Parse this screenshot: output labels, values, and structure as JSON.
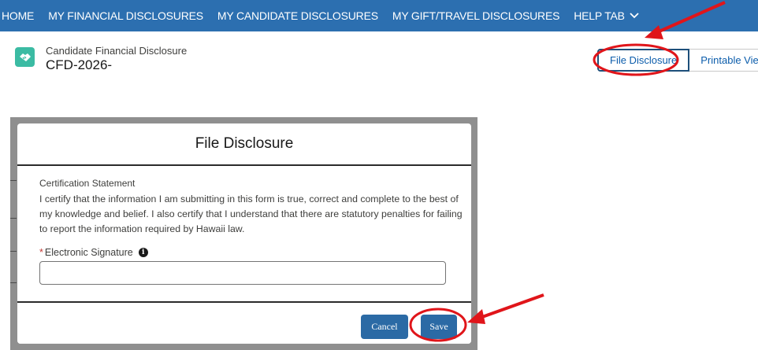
{
  "nav": {
    "items": [
      {
        "label": "HOME"
      },
      {
        "label": "MY FINANCIAL DISCLOSURES"
      },
      {
        "label": "MY CANDIDATE DISCLOSURES"
      },
      {
        "label": "MY GIFT/TRAVEL DISCLOSURES"
      },
      {
        "label": "HELP TAB"
      }
    ],
    "help_icon": "chevron-down-icon"
  },
  "record": {
    "type": "Candidate Financial Disclosure",
    "name": "CFD-2026-",
    "icon": "handshake-icon",
    "actions": {
      "file_disclosure": "File Disclosure",
      "printable_view": "Printable View"
    }
  },
  "modal": {
    "title": "File Disclosure",
    "cert_title": "Certification Statement",
    "cert_text": "I certify that the information I am submitting in this form is true, correct and complete to the best of my knowledge and belief. I also certify that I understand that there are statutory penalties for failing to report the information required by Hawaii law.",
    "field": {
      "required_mark": "*",
      "label": "Electronic Signature",
      "value": ""
    },
    "buttons": {
      "cancel": "Cancel",
      "save": "Save"
    }
  },
  "colors": {
    "nav_bg": "#2c6fb0",
    "brand_button": "#2b6aa5",
    "record_icon": "#3bbba3",
    "annotation_red": "#e0151a"
  }
}
